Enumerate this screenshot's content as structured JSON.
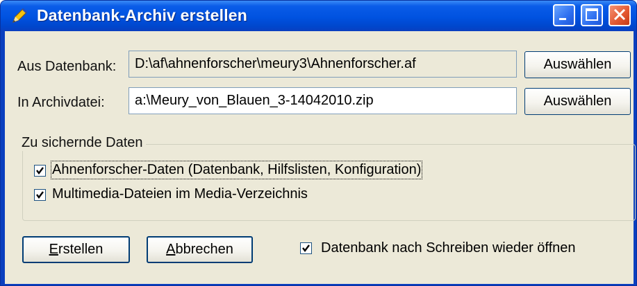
{
  "window": {
    "title": "Datenbank-Archiv erstellen",
    "icon": "pencil-icon",
    "controls": [
      "minimize-icon",
      "maximize-icon",
      "close-icon"
    ]
  },
  "source": {
    "label": "Aus Datenbank:",
    "value": "D:\\af\\ahnenforscher\\meury3\\Ahnenforscher.af",
    "button": "Auswählen"
  },
  "target": {
    "label": "In Archivdatei:",
    "value": "a:\\Meury_von_Blauen_3-14042010.zip",
    "button": "Auswählen"
  },
  "group": {
    "legend": "Zu sichernde Daten",
    "options": [
      {
        "label": "Ahnenforscher-Daten (Datenbank, Hilfslisten, Konfiguration)",
        "checked": true
      },
      {
        "label": "Multimedia-Dateien im Media-Verzeichnis",
        "checked": true
      }
    ]
  },
  "actions": {
    "create_mnemonic": "E",
    "create_rest": "rstellen",
    "cancel_mnemonic": "A",
    "cancel_rest": "bbrechen"
  },
  "reopen": {
    "label": "Datenbank nach Schreiben wieder öffnen",
    "checked": true
  },
  "colors": {
    "titlebar": "#0054e3",
    "client": "#ece9d8",
    "close_button": "#e2562f"
  }
}
